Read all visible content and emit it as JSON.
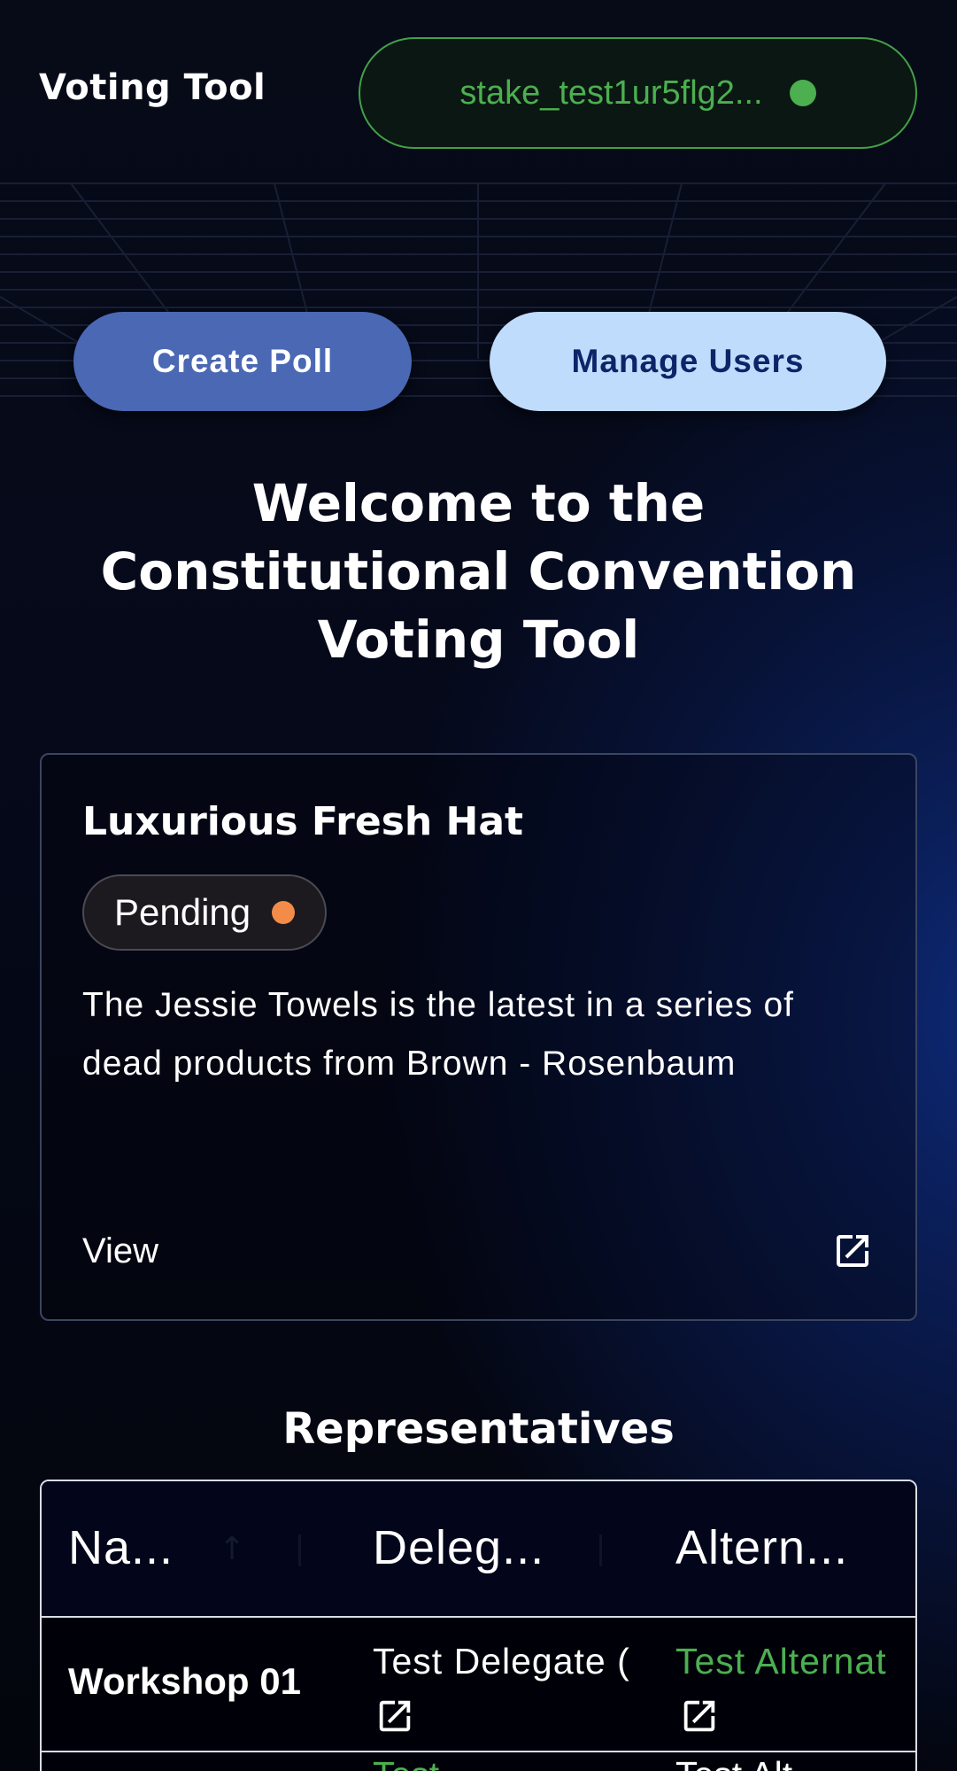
{
  "header": {
    "app_title": "Voting Tool",
    "wallet_address": "stake_test1ur5flg2..."
  },
  "actions": {
    "create_poll": "Create Poll",
    "manage_users": "Manage Users"
  },
  "welcome": {
    "line1": "Welcome to the",
    "line2": "Constitutional Convention",
    "line3": "Voting Tool"
  },
  "poll_card": {
    "title": "Luxurious Fresh Hat",
    "status": "Pending",
    "description": "The Jessie Towels is the latest in a series of dead products from Brown - Rosenbaum",
    "view_label": "View"
  },
  "representatives": {
    "title": "Representatives",
    "columns": [
      "Na...",
      "Deleg...",
      "Altern..."
    ],
    "rows": [
      {
        "name": "Workshop 01",
        "delegate": "Test Delegate (",
        "alternate": "Test Alternat"
      }
    ],
    "partial_row": {
      "delegate": "Test Dele",
      "alternate": "Test Alt"
    }
  },
  "colors": {
    "accent_green": "#4caf50",
    "pending_orange": "#f28c48",
    "create_button": "#4a68b3",
    "manage_button": "#bfdcfd"
  },
  "icons": {
    "wallet_status": "status-dot",
    "external": "external-link-icon"
  }
}
